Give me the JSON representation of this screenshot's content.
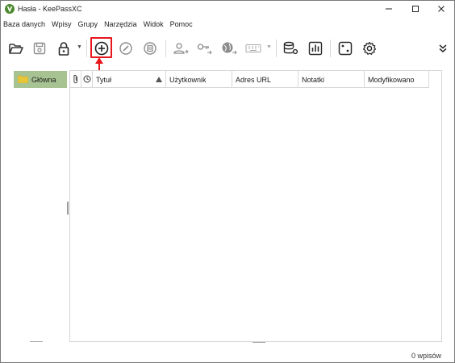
{
  "window": {
    "title": "Hasła - KeePassXC"
  },
  "menu": {
    "items": [
      "Baza danych",
      "Wpisy",
      "Grupy",
      "Narzędzia",
      "Widok",
      "Pomoc"
    ]
  },
  "toolbar": {
    "buttons": [
      {
        "name": "open-database",
        "icon": "folder-open-icon"
      },
      {
        "name": "save-database",
        "icon": "floppy-icon"
      },
      {
        "name": "lock-database",
        "icon": "lock-icon"
      },
      {
        "name": "add-entry",
        "icon": "plus-circle-icon",
        "highlighted": true
      },
      {
        "name": "edit-entry",
        "icon": "pencil-circle-icon"
      },
      {
        "name": "delete-entry",
        "icon": "trash-circle-icon"
      },
      {
        "name": "copy-username",
        "icon": "user-arrow-icon"
      },
      {
        "name": "copy-password",
        "icon": "key-arrow-icon"
      },
      {
        "name": "copy-url",
        "icon": "globe-arrow-icon"
      },
      {
        "name": "autotype",
        "icon": "keyboard-icon"
      },
      {
        "name": "database-settings",
        "icon": "database-gear-icon"
      },
      {
        "name": "database-reports",
        "icon": "chart-icon"
      },
      {
        "name": "password-generator",
        "icon": "dice-icon"
      },
      {
        "name": "settings",
        "icon": "gear-icon"
      },
      {
        "name": "more",
        "icon": "chevron-double-down-icon"
      }
    ],
    "highlight_color": "#e8161c"
  },
  "groups": {
    "root": "Główna"
  },
  "table": {
    "columns": [
      "",
      "",
      "Tytuł",
      "Użytkownik",
      "Adres URL",
      "Notatki",
      "Modyfikowano"
    ],
    "rows": []
  },
  "status": {
    "count_text": "0 wpisów"
  },
  "colors": {
    "selected_group": "#a7c392",
    "accent_red": "#e8161c",
    "icon_gray": "#3a3a3a"
  }
}
